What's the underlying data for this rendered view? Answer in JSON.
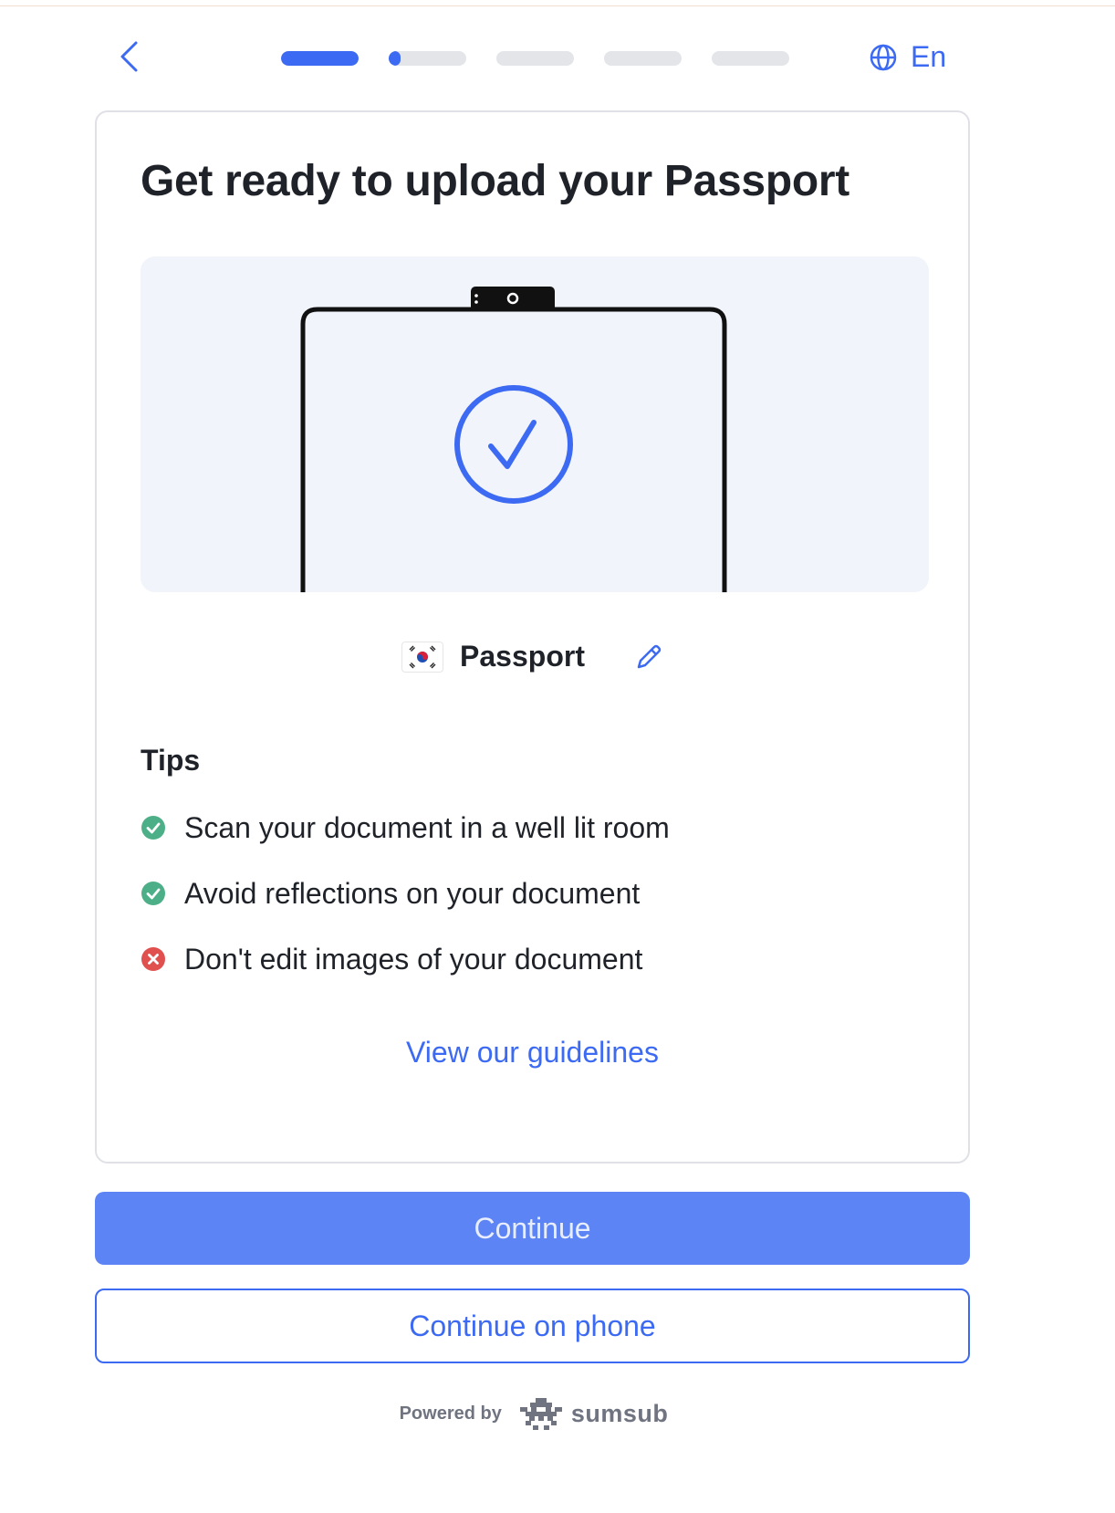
{
  "header": {
    "progress": [
      1,
      0.15,
      0,
      0,
      0
    ],
    "language_label": "En"
  },
  "card": {
    "title": "Get ready to upload your Passport",
    "document": {
      "flag_icon": "south-korea-flag-icon",
      "name": "Passport"
    },
    "tips_title": "Tips",
    "tips": [
      {
        "text": "Scan your document in a well lit room",
        "status": "ok"
      },
      {
        "text": "Avoid reflections on your document",
        "status": "ok"
      },
      {
        "text": "Don't edit images of your document",
        "status": "bad"
      }
    ],
    "guidelines_link": "View our guidelines"
  },
  "actions": {
    "continue_label": "Continue",
    "continue_on_phone_label": "Continue on phone"
  },
  "footer": {
    "powered_by": "Powered by",
    "brand": "sumsub"
  },
  "colors": {
    "accent": "#3d6af2",
    "primary_button": "#5d84f5",
    "ok": "#4caf87",
    "bad": "#e0504f",
    "illustration_bg": "#f1f4fb"
  }
}
